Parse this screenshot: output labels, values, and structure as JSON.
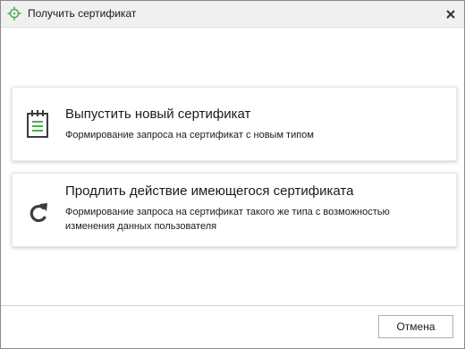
{
  "window": {
    "title": "Получить сертификат",
    "app_icon": "crosshair-logo-icon",
    "close_icon": "close-icon"
  },
  "options": [
    {
      "icon": "calendar-document-icon",
      "title": "Выпустить новый сертификат",
      "description": "Формирование запроса на сертификат с новым типом"
    },
    {
      "icon": "refresh-icon",
      "title": "Продлить действие имеющегося сертификата",
      "description": "Формирование запроса на сертификат такого же типа с возможностью изменения данных пользователя"
    }
  ],
  "footer": {
    "cancel_label": "Отмена"
  },
  "colors": {
    "accent_green": "#4caf50",
    "icon_dark": "#3c3c3c",
    "titlebar_bg": "#f0f0f0"
  }
}
